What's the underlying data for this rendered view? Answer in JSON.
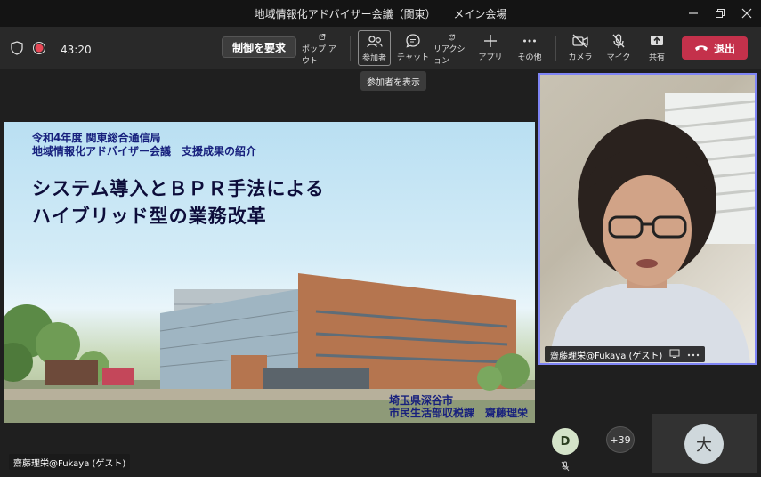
{
  "window": {
    "title": "地域情報化アドバイザー会議（関東）",
    "subtitle": "メイン会場"
  },
  "toolbar": {
    "timer": "43:20",
    "request_control": "制御を要求",
    "buttons": [
      {
        "label": "ポップ アウト",
        "icon": "popout-icon"
      },
      {
        "label": "参加者",
        "icon": "people-icon"
      },
      {
        "label": "チャット",
        "icon": "chat-icon"
      },
      {
        "label": "リアクション",
        "icon": "reaction-icon"
      },
      {
        "label": "アプリ",
        "icon": "plus-icon"
      },
      {
        "label": "その他",
        "icon": "more-icon"
      },
      {
        "label": "カメラ",
        "icon": "camera-off-icon"
      },
      {
        "label": "マイク",
        "icon": "mic-off-icon"
      },
      {
        "label": "共有",
        "icon": "share-icon"
      }
    ],
    "leave": "退出",
    "tooltip": "参加者を表示"
  },
  "colors": {
    "accent": "#7f85f5",
    "leave": "#c4314b",
    "recording": "#e74856"
  },
  "slide": {
    "org_line1": "令和4年度 関東総合通信局",
    "org_line2": "地域情報化アドバイザー会議　支援成果の紹介",
    "title_line1": "システム導入とＢＰＲ手法による",
    "title_line2": "ハイブリッド型の業務改革",
    "presenter_line1": "埼玉県深谷市",
    "presenter_line2": "市民生活部収税課　齋藤理栄"
  },
  "stage": {
    "speaker_label": "齋藤理栄@Fukaya (ゲスト)"
  },
  "participants": {
    "video_name": "齋藤理栄@Fukaya (ゲスト)",
    "avatar_d": "D",
    "more_count": "+39",
    "avatar_dai": "大"
  }
}
